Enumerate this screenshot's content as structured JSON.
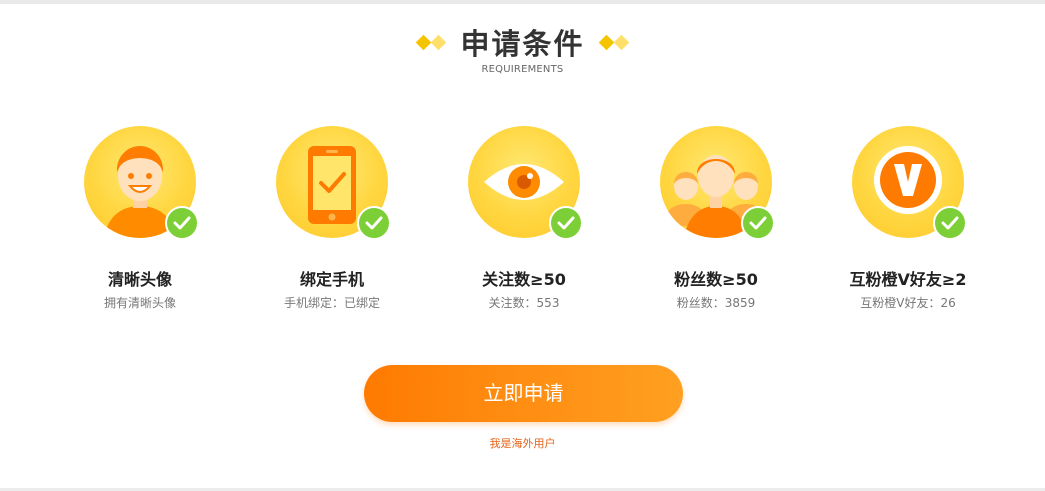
{
  "header": {
    "title": "申请条件",
    "subtitle": "REQUIREMENTS"
  },
  "requirements": [
    {
      "title": "清晰头像",
      "detail": "拥有清晰头像",
      "icon": "avatar-icon"
    },
    {
      "title": "绑定手机",
      "detail": "手机绑定：已绑定",
      "icon": "phone-icon"
    },
    {
      "title": "关注数≥50",
      "detail": "关注数：553",
      "icon": "eye-icon"
    },
    {
      "title": "粉丝数≥50",
      "detail": "粉丝数：3859",
      "icon": "fans-icon"
    },
    {
      "title": "互粉橙V好友≥2",
      "detail": "互粉橙V好友：26",
      "icon": "orange-v-icon"
    }
  ],
  "status_icon": "check-circle-icon",
  "apply_button": "立即申请",
  "overseas_link": "我是海外用户",
  "colors": {
    "accent": "#ff8400",
    "circle": "#ffd640",
    "check": "#7dcf37",
    "link": "#e2631a"
  }
}
